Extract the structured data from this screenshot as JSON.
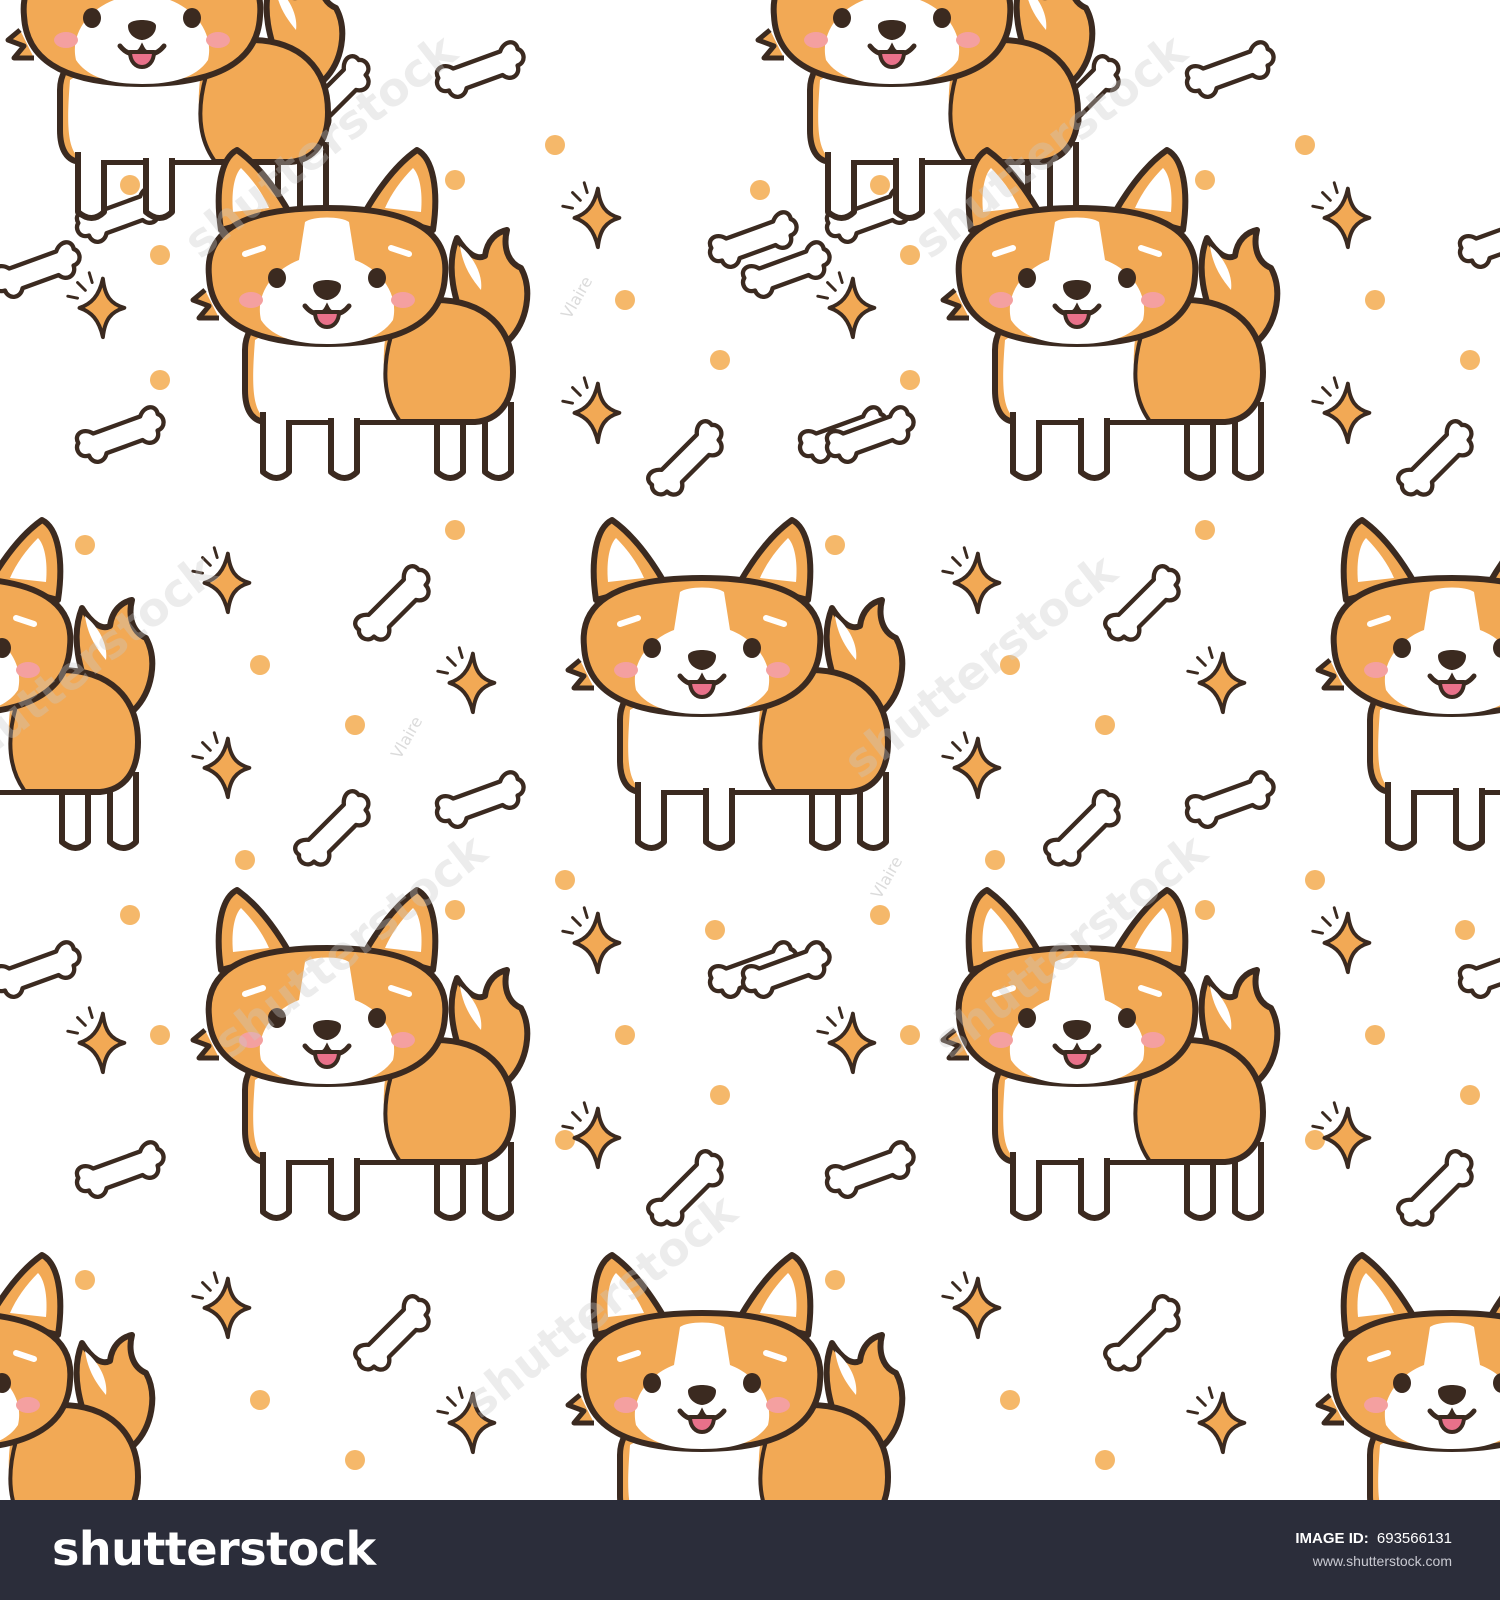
{
  "watermark": {
    "brand": "shutterstock",
    "artist": "Vlaire"
  },
  "footer": {
    "logo_text": "shutterstock",
    "image_id_label": "IMAGE ID:",
    "image_id_value": "693566131",
    "url": "www.shutterstock.com"
  },
  "colors": {
    "fur": "#f2a955",
    "fur_light": "#f6bf74",
    "outline": "#3b2a20",
    "white": "#ffffff",
    "ear_inner": "#ffffff",
    "blush": "#f4a0a0",
    "tongue": "#e9718a",
    "dot": "#f5b86a",
    "sparkle": "#f2a955",
    "footer_bg": "#2b2d3a"
  },
  "pattern": {
    "motifs": [
      "corgi",
      "bone",
      "sparkle",
      "dot"
    ]
  }
}
